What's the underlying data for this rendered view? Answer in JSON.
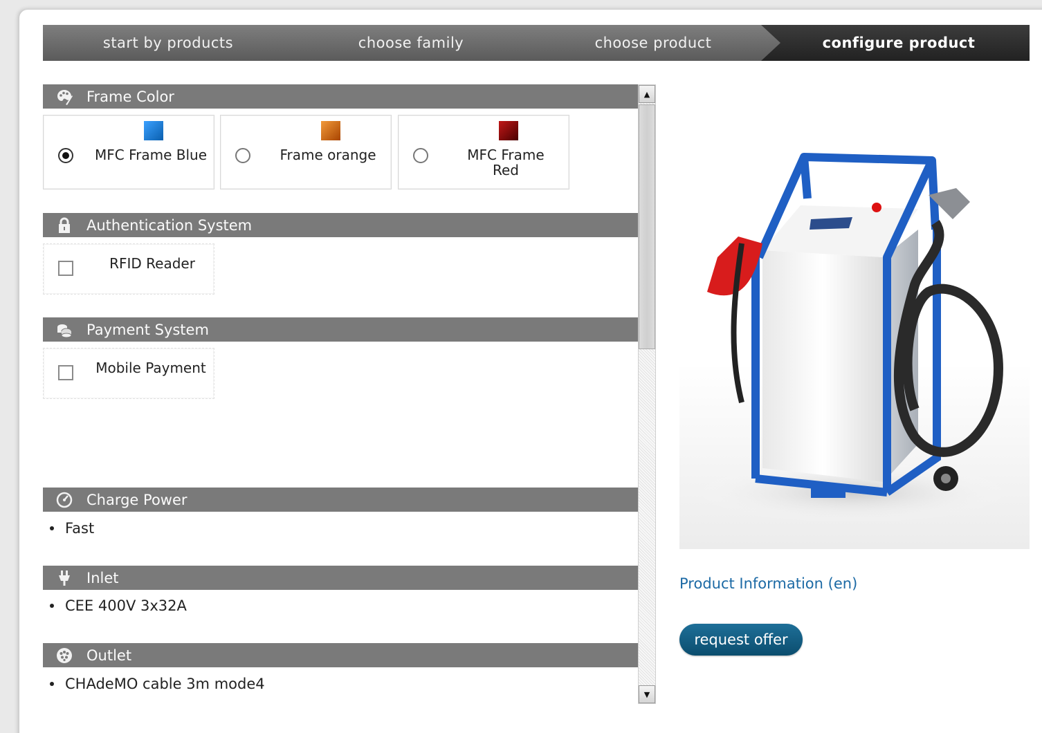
{
  "wizard": {
    "steps": [
      {
        "label": "start by products"
      },
      {
        "label": "choose family"
      },
      {
        "label": "choose product"
      },
      {
        "label": "configure product"
      }
    ]
  },
  "sections": {
    "frame_color": {
      "title": "Frame Color",
      "icon": "palette-icon",
      "options": [
        {
          "label": "MFC Frame Blue",
          "color": "#1b7fd6",
          "selected": true
        },
        {
          "label": "Frame orange",
          "color": "#d9650e",
          "selected": false
        },
        {
          "label": "MFC Frame Red",
          "color": "#8a0a0a",
          "selected": false
        }
      ]
    },
    "authentication": {
      "title": "Authentication System",
      "icon": "lock-icon",
      "options": [
        {
          "label": "RFID Reader",
          "checked": false
        }
      ]
    },
    "payment": {
      "title": "Payment System",
      "icon": "coins-icon",
      "options": [
        {
          "label": "Mobile Payment",
          "checked": false
        }
      ]
    },
    "charge_power": {
      "title": "Charge Power",
      "icon": "gauge-icon",
      "items": [
        "Fast"
      ]
    },
    "inlet": {
      "title": "Inlet",
      "icon": "plug-icon",
      "items": [
        "CEE 400V 3x32A"
      ]
    },
    "outlet": {
      "title": "Outlet",
      "icon": "socket-icon",
      "items": [
        "CHAdeMO cable 3m mode4"
      ]
    }
  },
  "product": {
    "image": "ev-charger-cart-image",
    "info_link": "Product Information (en)",
    "request_button": "request offer"
  },
  "colors": {
    "step_active": "#2a2a2a",
    "step_inactive": "#6c6c6c",
    "section_header": "#7a7a7a",
    "link": "#1c6aa5",
    "button": "#0b4d6e"
  }
}
